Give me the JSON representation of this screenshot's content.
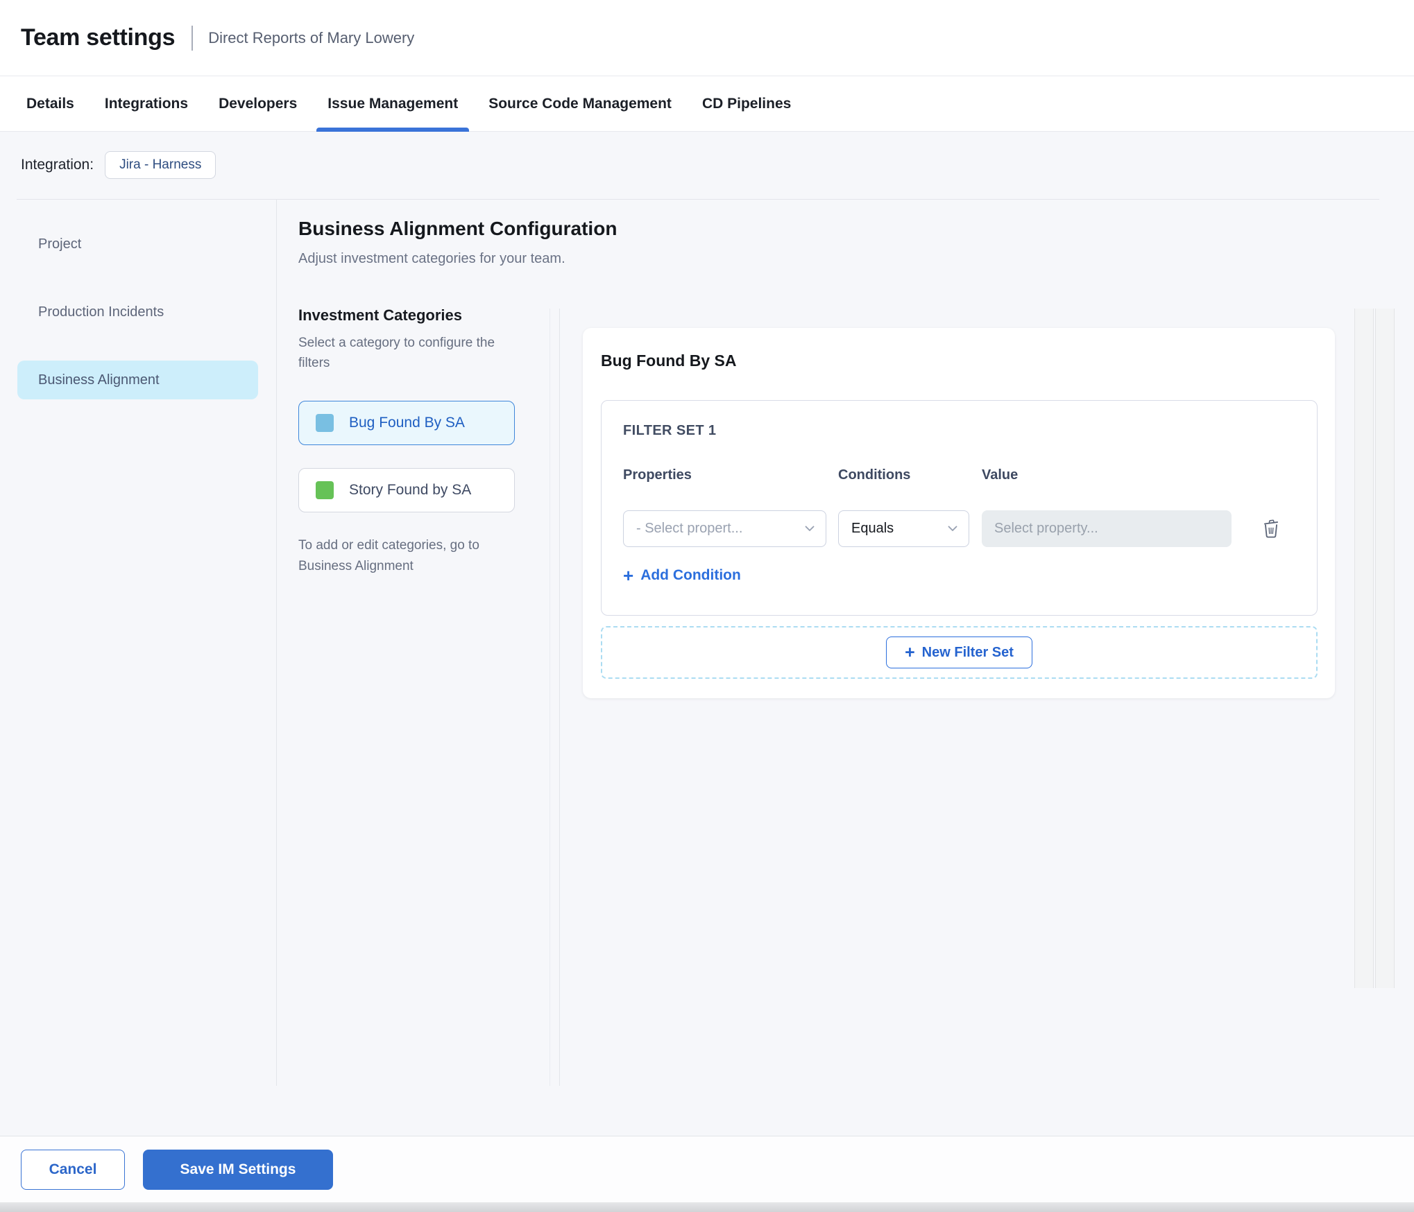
{
  "header": {
    "title": "Team settings",
    "subtitle": "Direct Reports of Mary Lowery"
  },
  "tabs": [
    {
      "label": "Details",
      "active": false
    },
    {
      "label": "Integrations",
      "active": false
    },
    {
      "label": "Developers",
      "active": false
    },
    {
      "label": "Issue Management",
      "active": true
    },
    {
      "label": "Source Code Management",
      "active": false
    },
    {
      "label": "CD Pipelines",
      "active": false
    }
  ],
  "integration": {
    "label": "Integration:",
    "value": "Jira - Harness"
  },
  "sidebar": {
    "items": [
      {
        "label": "Project",
        "selected": false
      },
      {
        "label": "Production Incidents",
        "selected": false
      },
      {
        "label": "Business Alignment",
        "selected": true
      }
    ]
  },
  "main": {
    "heading": "Business Alignment Configuration",
    "subheading": "Adjust investment categories for your team.",
    "categories": {
      "title": "Investment Categories",
      "helper": "Select a category to configure the filters",
      "items": [
        {
          "label": "Bug Found By SA",
          "swatch_color": "#79bfe2",
          "selected": true
        },
        {
          "label": "Story Found by SA",
          "swatch_color": "#66c257",
          "selected": false
        }
      ],
      "note": "To add or edit categories, go to Business Alignment"
    },
    "filter_panel": {
      "title": "Bug Found By SA",
      "filter_set_title": "FILTER SET 1",
      "columns": {
        "properties": "Properties",
        "conditions": "Conditions",
        "value": "Value"
      },
      "property_placeholder": "- Select propert...",
      "condition_value": "Equals",
      "value_placeholder": "Select property...",
      "add_condition_label": "Add Condition",
      "new_filter_set_label": "New Filter Set"
    }
  },
  "footer": {
    "cancel_label": "Cancel",
    "save_label": "Save IM Settings"
  },
  "icons": {
    "plus": "+"
  },
  "colors": {
    "accent_blue": "#2c6fdd",
    "save_button_bg": "#3470cf",
    "tab_underline": "#3a73d8",
    "sidebar_selected_bg": "#cdeefb",
    "category_selected_bg": "#eaf7fd",
    "category_selected_border": "#3e86da",
    "dashed_zone_border": "#abdcf2",
    "value_input_bg": "#e8ecef"
  }
}
